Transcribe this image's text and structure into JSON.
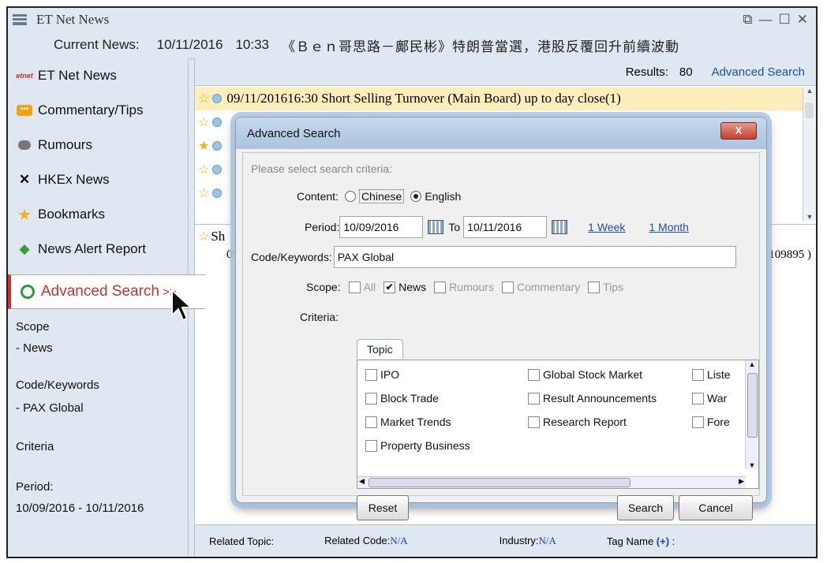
{
  "window": {
    "title": "ET Net News",
    "controls": [
      "⧉",
      "—",
      "☐",
      "✕"
    ]
  },
  "current_news": {
    "label": "Current News:",
    "date": "10/11/2016",
    "time": "10:33",
    "headline": "《Ｂｅｎ哥思路－鄺民彬》特朗普當選，港股反覆回升前續波動"
  },
  "sidebar": {
    "items": [
      {
        "label": "ET Net News",
        "icon": "etnet-logo-icon",
        "glyph": "etnet"
      },
      {
        "label": "Commentary/Tips",
        "icon": "chat-bubble-icon",
        "glyph": "💬"
      },
      {
        "label": "Rumours",
        "icon": "speech-icon",
        "glyph": "🗨"
      },
      {
        "label": "HKEx News",
        "icon": "x-icon",
        "glyph": "✕"
      },
      {
        "label": "Bookmarks",
        "icon": "star-icon",
        "glyph": "★"
      },
      {
        "label": "News Alert Report",
        "icon": "alert-arrow-icon",
        "glyph": "◆"
      }
    ],
    "active": {
      "label": "Advanced Search",
      "suffix": ">>",
      "icon": "search-icon",
      "glyph": "🔍"
    },
    "summary": {
      "scope_label": "Scope",
      "scope_value": "- News",
      "code_label": "Code/Keywords",
      "code_value": "- PAX Global",
      "criteria_label": "Criteria",
      "period_label": "Period:",
      "period_value": "10/09/2016  -  10/11/2016"
    }
  },
  "results": {
    "label": "Results:",
    "count": "80",
    "advanced_link": "Advanced Search"
  },
  "news_list": [
    {
      "text": "09/11/201616:30 Short Selling Turnover (Main Board) up to day close(1)",
      "starred": false,
      "selected": true
    },
    {
      "text": "",
      "starred": false,
      "selected": false
    },
    {
      "text": "",
      "starred": true,
      "selected": false
    },
    {
      "text": "",
      "starred": false,
      "selected": false
    },
    {
      "text": "",
      "starred": false,
      "selected": false
    }
  ],
  "detail": {
    "title_fragment": "Sh",
    "date_fragment": "09/",
    "id_fragment": "61109895 )"
  },
  "bottom_bar": {
    "related_topic": "Related Topic:",
    "related_code_label": "Related Code:",
    "related_code_value": "N/A",
    "industry_label": "Industry:",
    "industry_value": "N/A",
    "tag_label": "Tag Name",
    "tag_plus": "(+)",
    "tag_colon": ":"
  },
  "dialog": {
    "title": "Advanced Search",
    "close": "X",
    "hint": "Please select search criteria:",
    "content_label": "Content:",
    "content_options": [
      {
        "label": "Chinese",
        "checked": false
      },
      {
        "label": "English",
        "checked": true
      }
    ],
    "period_label": "Period:",
    "period_from": "10/09/2016",
    "period_to_label": "To",
    "period_to": "10/11/2016",
    "week_link": "1 Week",
    "month_link": "1 Month",
    "code_label": "Code/Keywords:",
    "code_value": "PAX Global",
    "scope_label": "Scope:",
    "scope_options": [
      {
        "label": "All",
        "checked": false,
        "enabled": false
      },
      {
        "label": "News",
        "checked": true,
        "enabled": true
      },
      {
        "label": "Rumours",
        "checked": false,
        "enabled": false
      },
      {
        "label": "Commentary",
        "checked": false,
        "enabled": false
      },
      {
        "label": "Tips",
        "checked": false,
        "enabled": false
      }
    ],
    "criteria_label": "Criteria:",
    "tab_label": "Topic",
    "topics": [
      [
        "IPO",
        "Global Stock Market",
        "Liste"
      ],
      [
        "Block Trade",
        "Result Announcements",
        "War"
      ],
      [
        "Market Trends",
        "Research Report",
        "Fore"
      ],
      [
        "Property Business"
      ]
    ],
    "reset": "Reset",
    "search": "Search",
    "cancel": "Cancel"
  }
}
